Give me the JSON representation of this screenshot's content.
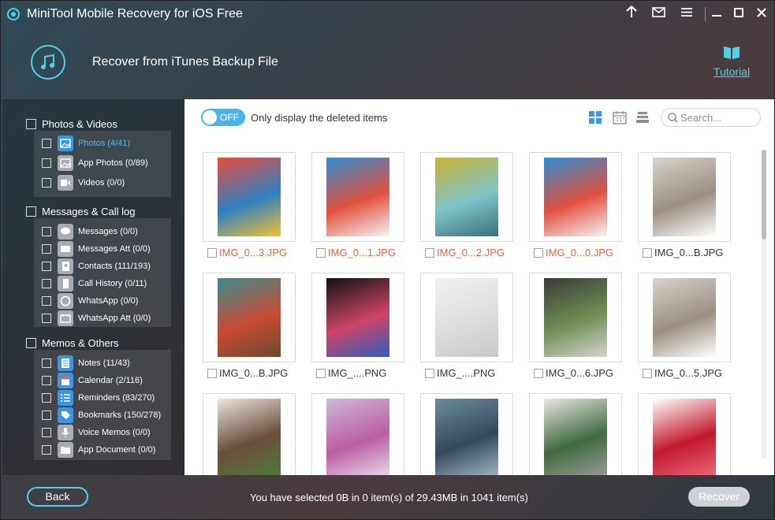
{
  "app": {
    "title": "MiniTool Mobile Recovery for iOS Free"
  },
  "titlebar": {
    "icons": [
      "upload-arrow-icon",
      "mail-icon",
      "menu-icon",
      "minimize-icon",
      "maximize-icon",
      "close-icon"
    ]
  },
  "header": {
    "heading": "Recover from iTunes Backup File",
    "tutorial_label": "Tutorial"
  },
  "sidebar": {
    "categories": [
      {
        "label": "Photos & Videos",
        "items": [
          {
            "label": "Photos (4/41)",
            "icon": "photos-icon",
            "active": true
          },
          {
            "label": "App Photos (0/89)",
            "icon": "app-photos-icon"
          },
          {
            "label": "Videos (0/0)",
            "icon": "videos-icon"
          }
        ]
      },
      {
        "label": "Messages & Call log",
        "items": [
          {
            "label": "Messages (0/0)",
            "icon": "messages-icon"
          },
          {
            "label": "Messages Att (0/0)",
            "icon": "messages-attachment-icon"
          },
          {
            "label": "Contacts (111/193)",
            "icon": "contacts-icon"
          },
          {
            "label": "Call History (0/11)",
            "icon": "call-history-icon"
          },
          {
            "label": "WhatsApp (0/0)",
            "icon": "whatsapp-icon"
          },
          {
            "label": "WhatsApp Att (0/0)",
            "icon": "whatsapp-attachment-icon"
          }
        ]
      },
      {
        "label": "Memos & Others",
        "items": [
          {
            "label": "Notes (11/43)",
            "icon": "notes-icon"
          },
          {
            "label": "Calendar (2/116)",
            "icon": "calendar-icon"
          },
          {
            "label": "Reminders (83/270)",
            "icon": "reminders-icon"
          },
          {
            "label": "Bookmarks (150/278)",
            "icon": "bookmarks-icon"
          },
          {
            "label": "Voice Memos (0/0)",
            "icon": "voice-memos-icon"
          },
          {
            "label": "App Document (0/0)",
            "icon": "app-document-icon"
          }
        ]
      }
    ]
  },
  "toolbar": {
    "toggle_label": "OFF",
    "filter_label": "Only display the deleted items",
    "search_placeholder": "Search..."
  },
  "files": [
    {
      "name": "IMG_0...3.JPG",
      "deleted": true
    },
    {
      "name": "IMG_0...1.JPG",
      "deleted": true
    },
    {
      "name": "IMG_0...2.JPG",
      "deleted": true
    },
    {
      "name": "IMG_0...0.JPG",
      "deleted": true
    },
    {
      "name": "IMG_0...B.JPG",
      "deleted": false
    },
    {
      "name": "IMG_0...B.JPG",
      "deleted": false
    },
    {
      "name": "IMG_....PNG",
      "deleted": false
    },
    {
      "name": "IMG_....PNG",
      "deleted": false
    },
    {
      "name": "IMG_0...6.JPG",
      "deleted": false
    },
    {
      "name": "IMG_0...5.JPG",
      "deleted": false
    },
    {
      "name": "",
      "deleted": false
    },
    {
      "name": "",
      "deleted": false
    },
    {
      "name": "",
      "deleted": false
    },
    {
      "name": "",
      "deleted": false
    },
    {
      "name": "",
      "deleted": false
    }
  ],
  "footer": {
    "back_label": "Back",
    "status": "You have selected 0B in 0 item(s) of 29.43MB in 1041 item(s)",
    "recover_label": "Recover"
  },
  "colors": {
    "accent": "#4fd1e6",
    "deleted_text": "#e8623c",
    "toggle_bg": "#4ab3e8",
    "selected_item": "#4fb8f0"
  }
}
